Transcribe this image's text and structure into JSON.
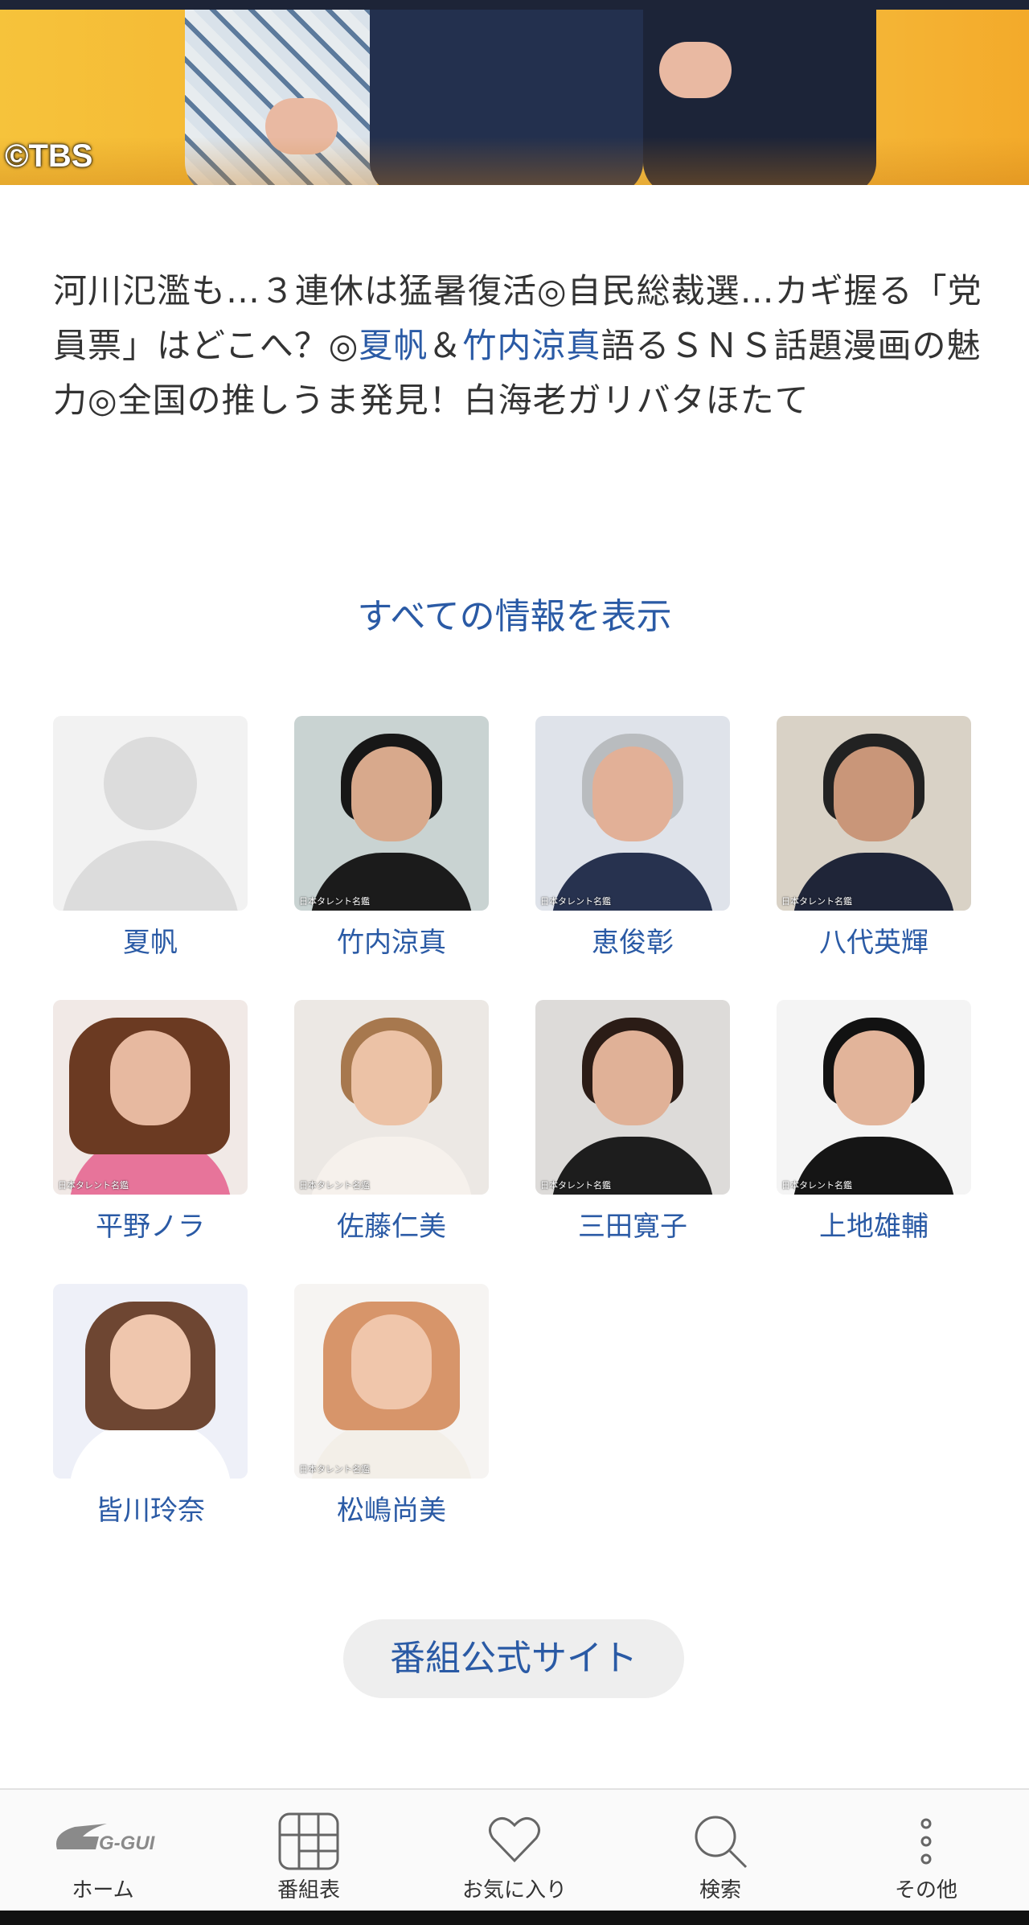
{
  "hero": {
    "copyright": "©TBS"
  },
  "description": {
    "part1": "河川氾濫も…３連休は猛暑復活◎自民総裁選…カギ握る「党員票」はどこへ？◎",
    "link1": "夏帆",
    "amp": "＆",
    "link2": "竹内涼真",
    "part2": "語るＳＮＳ話題漫画の魅力◎全国の推しうま発見！白海老ガリバタほたて"
  },
  "show_all": "すべての情報を表示",
  "cast": [
    {
      "name": "夏帆",
      "watermark": ""
    },
    {
      "name": "竹内涼真",
      "watermark": "日本タレント名鑑"
    },
    {
      "name": "恵俊彰",
      "watermark": "日本タレント名鑑"
    },
    {
      "name": "八代英輝",
      "watermark": "日本タレント名鑑"
    },
    {
      "name": "平野ノラ",
      "watermark": "日本タレント名鑑"
    },
    {
      "name": "佐藤仁美",
      "watermark": "日本タレント名鑑"
    },
    {
      "name": "三田寛子",
      "watermark": "日本タレント名鑑"
    },
    {
      "name": "上地雄輔",
      "watermark": "日本タレント名鑑"
    },
    {
      "name": "皆川玲奈",
      "watermark": ""
    },
    {
      "name": "松嶋尚美",
      "watermark": "日本タレント名鑑"
    }
  ],
  "official_site": "番組公式サイト",
  "tabbar": {
    "home": {
      "label": "ホーム",
      "logo": "G-GUIDE"
    },
    "schedule": {
      "label": "番組表"
    },
    "favorites": {
      "label": "お気に入り"
    },
    "search": {
      "label": "検索"
    },
    "other": {
      "label": "その他"
    }
  },
  "colors": {
    "accent": "#2a5aa5",
    "text": "#333333",
    "pill_bg": "#eeeeee"
  },
  "icons": [
    "g-guide-logo-icon",
    "grid-icon",
    "heart-icon",
    "search-icon",
    "more-vertical-icon"
  ]
}
